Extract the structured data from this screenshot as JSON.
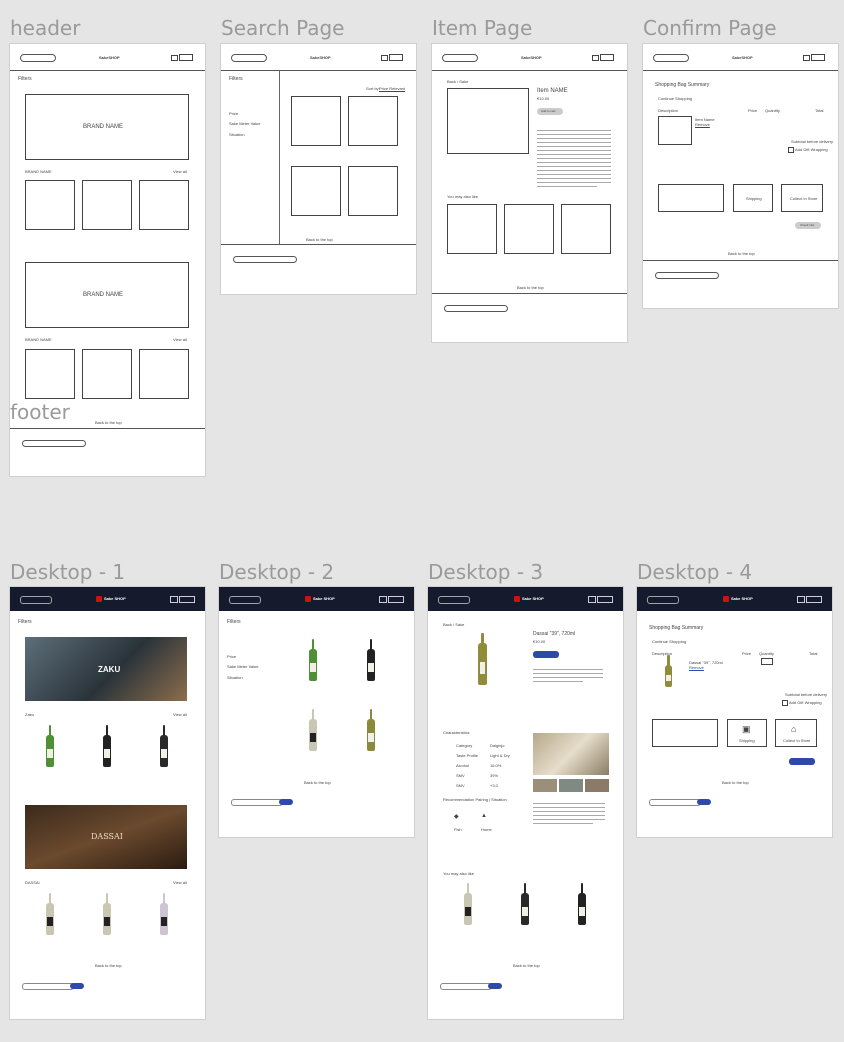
{
  "frames": {
    "header_label": "header",
    "search_label": "Search Page",
    "item_label": "Item Page",
    "confirm_label": "Confirm Page",
    "footer_label": "footer",
    "desktop1_label": "Desktop - 1",
    "desktop2_label": "Desktop - 2",
    "desktop3_label": "Desktop - 3",
    "desktop4_label": "Desktop - 4"
  },
  "wireframe": {
    "brand_name": "BRAND NAME",
    "brand_name_title": "BRAND NAME",
    "view_all": "View all",
    "filters": "Filters",
    "back_to_top": "Back to the top",
    "search_sake": "SakeSHOP",
    "item_name": "Item NAME",
    "item_price": "€10.00",
    "add_to_cart": "Add to cart",
    "you_may_also_like": "You may also like",
    "back_sake": "Back / Sake",
    "shopping_bag_summary": "Shopping Bag Summary",
    "continue_shopping": "Continue Shopping",
    "description": "Description",
    "price": "Price",
    "quantity": "Quantity",
    "total": "Total",
    "item_name_small": "Item Name",
    "remove": "Remove",
    "subtotal": "Subtotal before delivery",
    "gift_wrapping": "Add Gift Wrapping",
    "shipping": "Shipping",
    "collect_in_store": "Collect In Store",
    "checkout": "Check Out",
    "price_filter": "Price",
    "sake_meter_value": "Sake Meter Value",
    "situation": "Situation",
    "sort_by": "Sort by:",
    "sort_value": "Price Relevant"
  },
  "desktop": {
    "filters": "Filters",
    "zaku": "Zaku",
    "dassai": "DASSAI",
    "zaku_banner": "ZAKU",
    "dassai_banner": "DASSAI",
    "view_all": "View all",
    "back_to_top": "Back to the top",
    "sake_shop": "Sake SHOP",
    "item_title": "Dassai \"39\", 720ml",
    "item_price": "€10.00",
    "characteristics": "Characteristics",
    "recommendation": "Recommendation Pairing | Situation",
    "you_may_also_like": "You may also like",
    "shopping_bag_summary": "Shopping Bag Summary",
    "shipping": "Shipping",
    "collect_in_store": "Collect In Store",
    "subtotal": "Subtotal before delivery",
    "gift_wrapping": "Add Gift Wrapping",
    "character_rows": [
      [
        "Category",
        "Daiginjo"
      ],
      [
        "Taste Profile",
        "Light & Dry"
      ],
      [
        "Alcohol",
        "16.0%"
      ],
      [
        "SMV",
        "39%"
      ],
      [
        "SMV",
        "+3.0"
      ]
    ],
    "pair_fish": "Fish",
    "pair_home": "Home"
  },
  "colors": {
    "nav_bg": "#151b2c",
    "accent_blue": "#2e4aa8",
    "logo_red": "#cc1111"
  }
}
